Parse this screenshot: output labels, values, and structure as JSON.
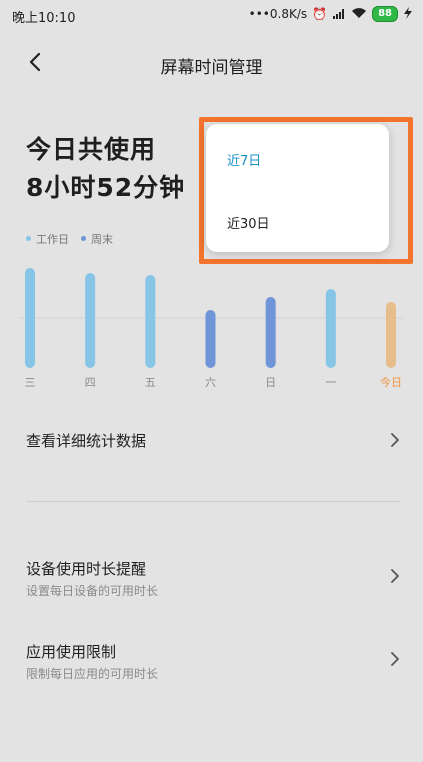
{
  "status_bar": {
    "time": "晚上10:10",
    "net_speed": "0.8K/s",
    "battery": "88"
  },
  "header": {
    "title": "屏幕时间管理"
  },
  "summary": {
    "line1": "今日共使用",
    "line2": "8小时52分钟"
  },
  "legend": [
    {
      "label": "工作日",
      "color": "#86c5e6"
    },
    {
      "label": "周末",
      "color": "#6f94d8"
    }
  ],
  "chart_data": {
    "type": "bar",
    "categories": [
      "三",
      "四",
      "五",
      "六",
      "日",
      "一",
      "今日"
    ],
    "values": [
      100,
      95,
      93,
      58,
      71,
      79,
      66
    ],
    "colors": [
      "#86c5e6",
      "#86c5e6",
      "#86c5e6",
      "#6f94d8",
      "#6f94d8",
      "#86c5e6",
      "#e6bd8b"
    ],
    "highlight_label_color": "#f0953c"
  },
  "menu": {
    "detail": {
      "label": "查看详细统计数据"
    },
    "device_reminder": {
      "label": "设备使用时长提醒",
      "sub": "设置每日设备的可用时长"
    },
    "app_limit": {
      "label": "应用使用限制",
      "sub": "限制每日应用的可用时长"
    }
  },
  "dropdown": {
    "options": [
      {
        "label": "近7日",
        "selected": true
      },
      {
        "label": "近30日",
        "selected": false
      }
    ]
  }
}
